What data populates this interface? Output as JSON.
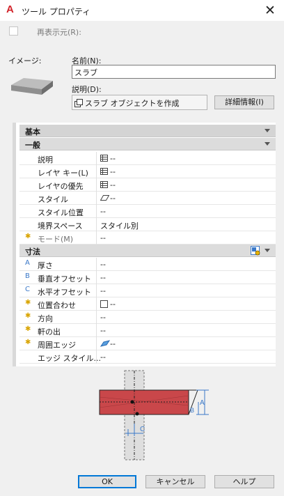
{
  "window": {
    "title": "ツール プロパティ",
    "close_glyph": "✕"
  },
  "redisplay": {
    "label": "再表示元(R):"
  },
  "image": {
    "label": "イメージ:"
  },
  "name_field": {
    "label": "名前(N):",
    "value": "スラブ"
  },
  "description_field": {
    "label": "説明(D):",
    "value": "スラブ オブジェクトを作成"
  },
  "detail_button": {
    "label": "詳細情報(I)"
  },
  "grid": {
    "sections": {
      "basic": "基本",
      "general": "一般",
      "dimensions": "寸法"
    },
    "general_rows": [
      {
        "name": "説明",
        "value": "--",
        "icon": "table-icon"
      },
      {
        "name": "レイヤ キー(L)",
        "value": "--",
        "icon": "table-icon"
      },
      {
        "name": "レイヤの優先",
        "value": "--",
        "icon": "table-icon"
      },
      {
        "name": "スタイル",
        "value": "--",
        "icon": "style-icon"
      },
      {
        "name": "スタイル位置",
        "value": "--"
      },
      {
        "name": "境界スペース",
        "value": "スタイル別"
      },
      {
        "name": "モード(M)",
        "value": "--",
        "marker": "✱"
      }
    ],
    "dimension_rows": [
      {
        "name": "厚さ",
        "value": "--",
        "marker": "A"
      },
      {
        "name": "垂直オフセット",
        "value": "--",
        "marker": "B"
      },
      {
        "name": "水平オフセット",
        "value": "--",
        "marker": "C"
      },
      {
        "name": "位置合わせ",
        "value": "--",
        "marker": "✱",
        "icon": "checkbox-icon"
      },
      {
        "name": "方向",
        "value": "--",
        "marker": "✱"
      },
      {
        "name": "軒の出",
        "value": "--",
        "marker": "✱"
      },
      {
        "name": "周囲エッジ",
        "value": "--",
        "marker": "✱",
        "icon": "edge-icon"
      },
      {
        "name": "エッジ スタイル...",
        "value": "--"
      }
    ],
    "diagram_labels": {
      "a": "A",
      "b": "B",
      "c": "C"
    }
  },
  "buttons": {
    "ok": "OK",
    "cancel": "キャンセル",
    "help": "ヘルプ"
  },
  "colors": {
    "accent": "#0078d7",
    "marker": "#d9a400",
    "letter": "#3a78c8",
    "slab": "#c9474a"
  }
}
